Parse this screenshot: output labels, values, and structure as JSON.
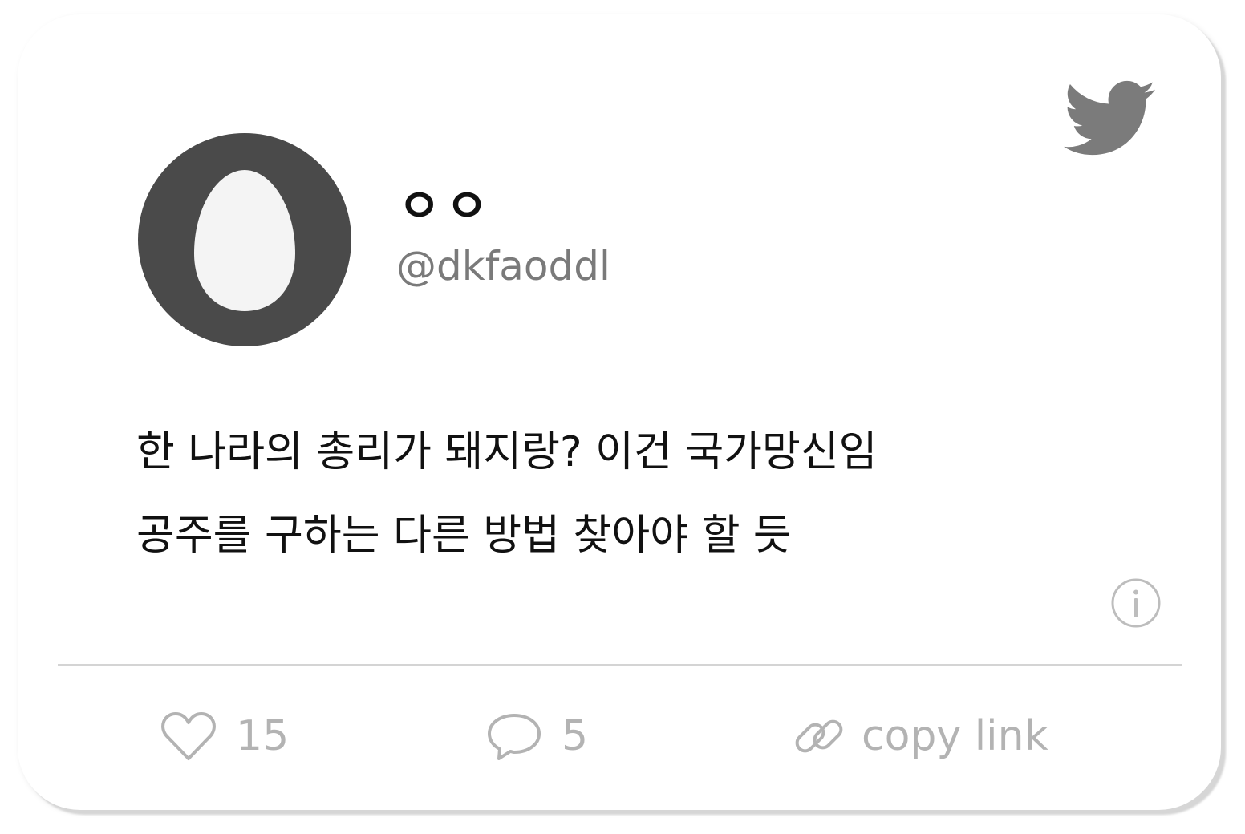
{
  "profile": {
    "display_name": "ㅇㅇ",
    "handle": "@dkfaoddl",
    "avatar_icon": "egg-avatar-icon"
  },
  "tweet": {
    "lines": [
      "한 나라의 총리가 돼지랑? 이건 국가망신임",
      "공주를 구하는 다른 방법 찾아야 할 듯"
    ]
  },
  "actions": {
    "likes_count": "15",
    "replies_count": "5",
    "copy_link_label": "copy link"
  },
  "icons": {
    "brand": "twitter-bird-icon",
    "info": "info-icon",
    "like": "heart-icon",
    "reply": "speech-bubble-icon",
    "link": "link-icon"
  },
  "colors": {
    "avatar_ring": "#4a4a4a",
    "avatar_egg": "#f4f4f4",
    "brand_icon": "#7b7b7b",
    "handle": "#7a7a7a",
    "text": "#111111",
    "muted": "#b3b3b3",
    "divider": "#d4d4d4"
  }
}
